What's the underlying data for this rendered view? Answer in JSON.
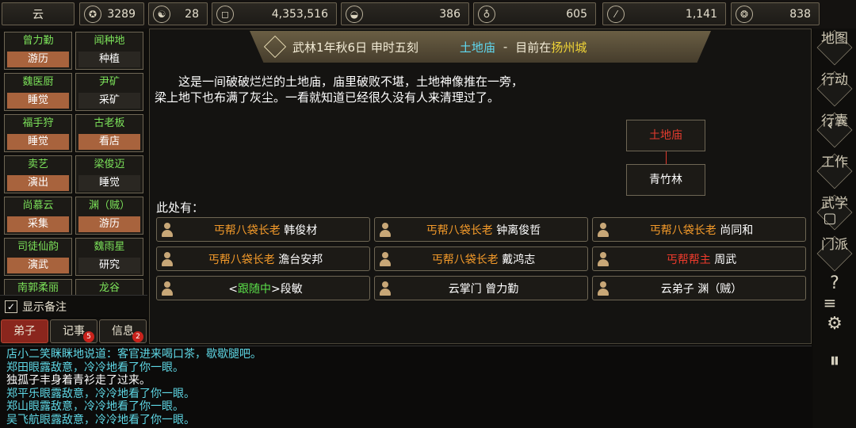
{
  "resources": [
    {
      "icon": "name-icon",
      "glyph": "",
      "value": "云"
    },
    {
      "icon": "copper-coin-icon",
      "glyph": "✪",
      "value": "3289"
    },
    {
      "icon": "yin-yang-icon",
      "glyph": "☯",
      "value": "28"
    },
    {
      "icon": "square-coin-icon",
      "glyph": "◻",
      "value": "4,353,516"
    },
    {
      "icon": "food-bowl-icon",
      "glyph": "◒",
      "value": "386"
    },
    {
      "icon": "gourd-icon",
      "glyph": "♁",
      "value": "605"
    },
    {
      "icon": "wood-log-icon",
      "glyph": "⁄",
      "value": "1,141"
    },
    {
      "icon": "ore-icon",
      "glyph": "❂",
      "value": "838"
    }
  ],
  "npcs": [
    {
      "name": "曾力勤",
      "action": "游历",
      "highlight": true
    },
    {
      "name": "闻种地",
      "action": "种植",
      "highlight": false
    },
    {
      "name": "魏医厨",
      "action": "睡觉",
      "highlight": true
    },
    {
      "name": "尹矿",
      "action": "采矿",
      "highlight": false
    },
    {
      "name": "福手狩",
      "action": "睡觉",
      "highlight": true
    },
    {
      "name": "古老板",
      "action": "看店",
      "highlight": true
    },
    {
      "name": "卖艺",
      "action": "演出",
      "highlight": true
    },
    {
      "name": "梁俊迈",
      "action": "睡觉",
      "highlight": false
    },
    {
      "name": "尚慕云",
      "action": "采集",
      "highlight": true
    },
    {
      "name": "渊（贼）",
      "action": "游历",
      "highlight": true
    },
    {
      "name": "司徒仙韵",
      "action": "演武",
      "highlight": true
    },
    {
      "name": "魏雨星",
      "action": "研究",
      "highlight": false
    },
    {
      "name": "南郭柔丽",
      "action": "",
      "highlight": false
    },
    {
      "name": "龙谷",
      "action": "",
      "highlight": false
    }
  ],
  "memo": {
    "check": "✓",
    "label": "显示备注"
  },
  "tabs": [
    {
      "label": "弟子",
      "badge": ""
    },
    {
      "label": "记事",
      "badge": "5"
    },
    {
      "label": "信息",
      "badge": "2"
    }
  ],
  "banner": {
    "date": "武林1年秋6日 申时五刻",
    "place": "土地庙",
    "sep": "-",
    "current_prefix": "目前在",
    "city": "扬州城"
  },
  "description": "这是一间破破烂烂的土地庙，庙里破败不堪，土地神像推在一旁，梁上地下也布满了灰尘。一看就知道已经很久没有人来清理过了。",
  "map": {
    "current": "土地庙",
    "neighbor": "青竹林"
  },
  "here_label": "此处有：",
  "people": [
    {
      "title": "丐帮八袋长老",
      "title_color": "orange",
      "name": "韩俊材"
    },
    {
      "title": "丐帮八袋长老",
      "title_color": "orange",
      "name": "钟离俊哲"
    },
    {
      "title": "丐帮八袋长老",
      "title_color": "orange",
      "name": "尚同和"
    },
    {
      "title": "丐帮八袋长老",
      "title_color": "orange",
      "name": "澹台安邦"
    },
    {
      "title": "丐帮八袋长老",
      "title_color": "orange",
      "name": "戴鸿志"
    },
    {
      "title": "丐帮帮主",
      "title_color": "red",
      "name": "周武"
    },
    {
      "title": "<跟随中>",
      "title_color": "follow",
      "name": "段敏"
    },
    {
      "title": "云掌门",
      "title_color": "white",
      "name": "曾力勤"
    },
    {
      "title": "云弟子",
      "title_color": "white",
      "name": "渊（贼）"
    }
  ],
  "right_menu": [
    {
      "icon": "map-icon",
      "label": "地图"
    },
    {
      "icon": "action-icon",
      "label": "行动"
    },
    {
      "icon": "bag-icon",
      "label": "行囊"
    },
    {
      "icon": "work-icon",
      "label": "工作"
    },
    {
      "icon": "martial-icon",
      "label": "武学"
    },
    {
      "icon": "sect-icon",
      "label": "门派"
    }
  ],
  "log": [
    {
      "text": "店小二笑眯眯地说道：客官进来喝口茶，歇歇腿吧。",
      "color": "cyan"
    },
    {
      "text": "郑田眼露敌意，冷冷地看了你一眼。",
      "color": "cyan"
    },
    {
      "text": "独孤子丰身着青衫走了过来。",
      "color": "white"
    },
    {
      "text": "郑平乐眼露敌意，冷冷地看了你一眼。",
      "color": "cyan"
    },
    {
      "text": "郑山眼露敌意，冷冷地看了你一眼。",
      "color": "cyan"
    },
    {
      "text": "吴飞航眼露敌意，冷冷地看了你一眼。",
      "color": "cyan"
    }
  ]
}
